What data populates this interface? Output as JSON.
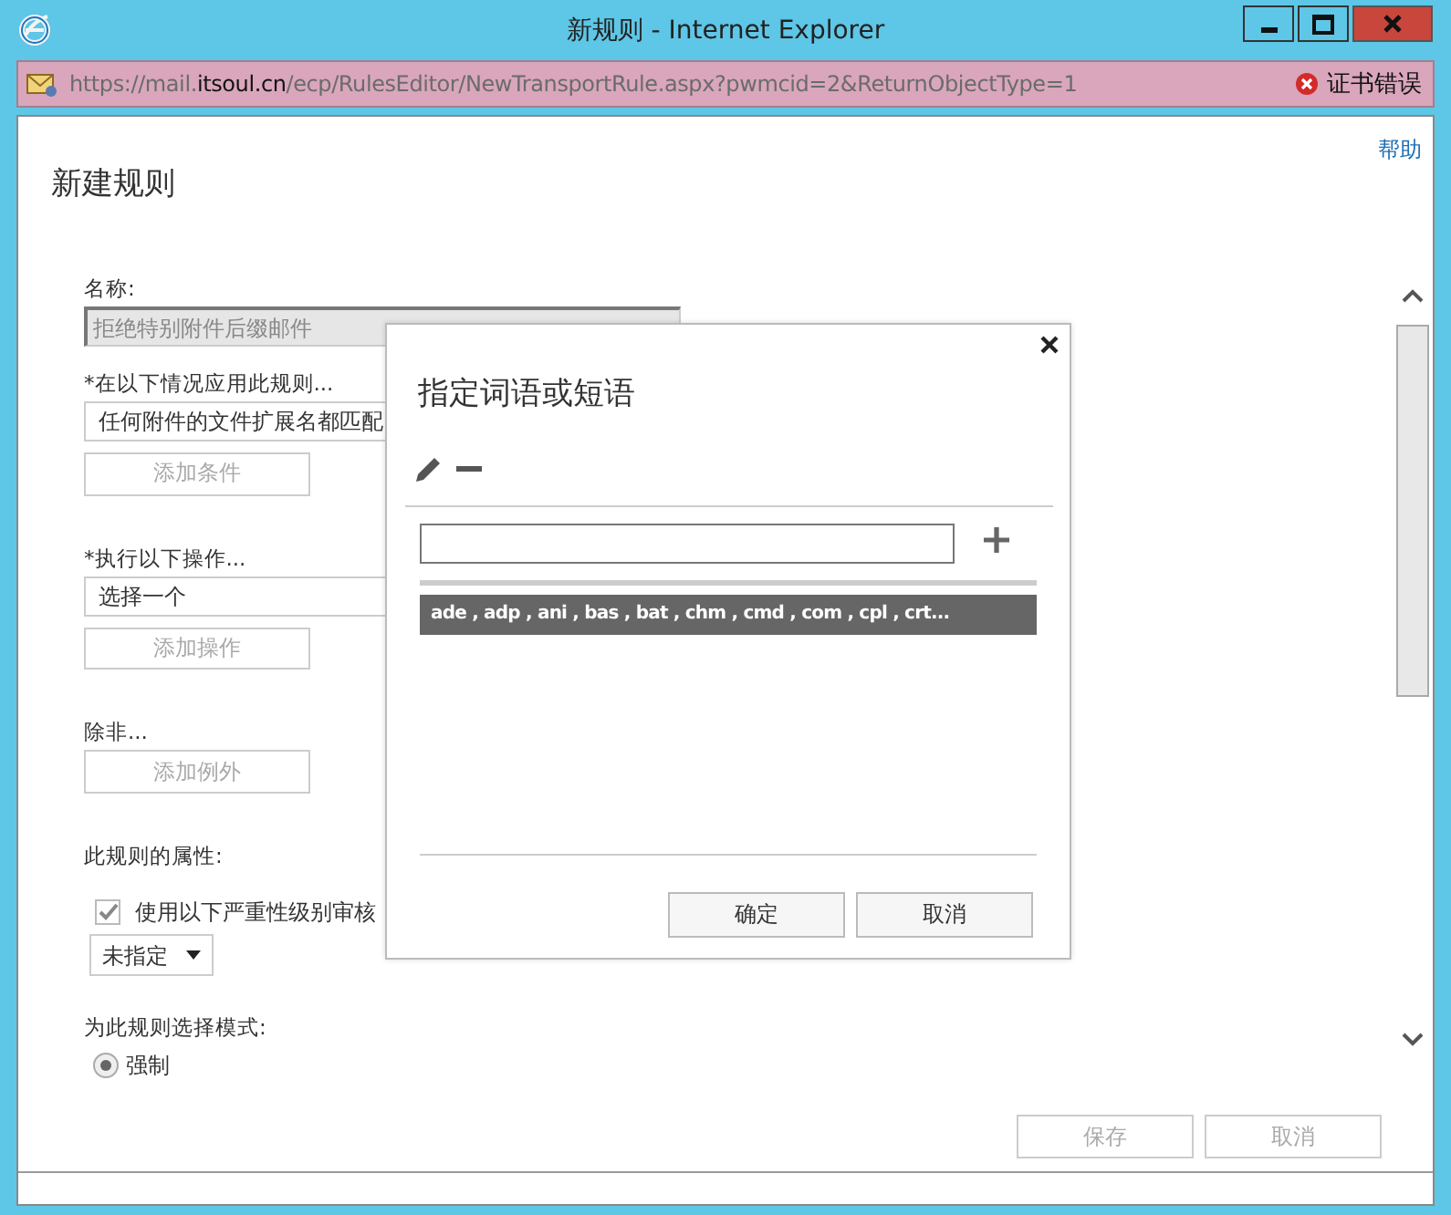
{
  "window": {
    "title": "新规则 - Internet Explorer"
  },
  "address_bar": {
    "url_start": "https://mail.",
    "url_domain": "itsoul.cn",
    "url_end": "/ecp/RulesEditor/NewTransportRule.aspx?pwmcid=2&ReturnObjectType=1",
    "cert_error": "证书错误"
  },
  "help_link": "帮助",
  "page_title": "新建规则",
  "form": {
    "name": {
      "label": "名称:",
      "value": "拒绝特别附件后缀邮件",
      "disabled": true
    },
    "condition": {
      "label": "*在以下情况应用此规则...",
      "value": "任何附件的文件扩展名都匹配",
      "button": "添加条件",
      "button_disabled": true
    },
    "action": {
      "label": "*执行以下操作...",
      "value": "选择一个",
      "button": "添加操作",
      "button_disabled": true
    },
    "exception": {
      "label": "除非...",
      "button": "添加例外",
      "button_disabled": true
    },
    "properties": {
      "label": "此规则的属性:",
      "audit_label": "使用以下严重性级别审核",
      "audit_checked": true,
      "severity": "未指定"
    },
    "mode": {
      "label": "为此规则选择模式:",
      "options": [
        {
          "label": "强制",
          "selected": true
        }
      ]
    }
  },
  "footer_buttons": [
    {
      "label": "保存",
      "disabled": true
    },
    {
      "label": "取消",
      "disabled": true
    }
  ],
  "dialog": {
    "title": "指定词语或短语",
    "items": [
      {
        "text": "ade , adp , ani , bas , bat , chm , cmd , com , cpl , crt...",
        "selected": true
      }
    ],
    "buttons": [
      {
        "label": "确定"
      },
      {
        "label": "取消"
      }
    ]
  }
}
